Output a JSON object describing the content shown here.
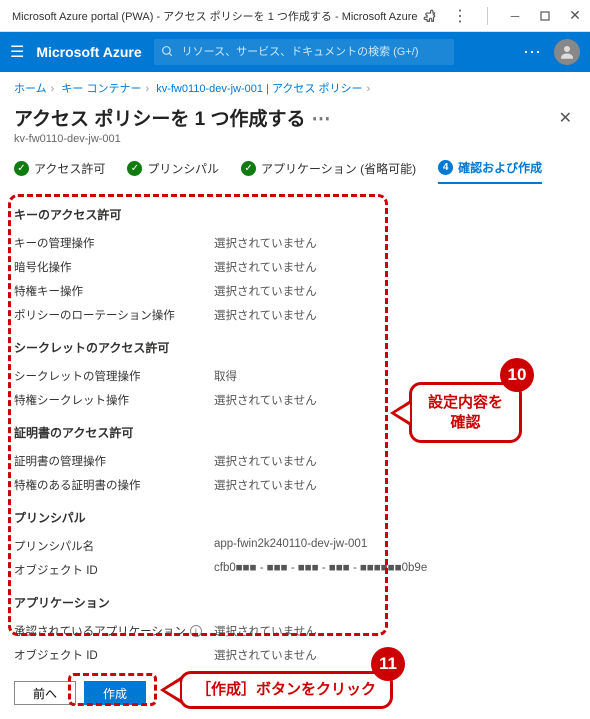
{
  "chrome": {
    "title": "Microsoft Azure portal (PWA) - アクセス ポリシーを 1 つ作成する - Microsoft Azure"
  },
  "topbar": {
    "brand": "Microsoft Azure",
    "search_placeholder": "リソース、サービス、ドキュメントの検索 (G+/)"
  },
  "breadcrumb": {
    "items": [
      "ホーム",
      "キー コンテナー",
      "kv-fw0110-dev-jw-001 | アクセス ポリシー"
    ]
  },
  "header": {
    "title": "アクセス ポリシーを 1 つ作成する",
    "subtitle": "kv-fw0110-dev-jw-001"
  },
  "steps": {
    "s0": "アクセス許可",
    "s1": "プリンシパル",
    "s2": "アプリケーション (省略可能)",
    "s3": "確認および作成"
  },
  "sections": {
    "key_perms": {
      "title": "キーのアクセス許可",
      "r0": {
        "lbl": "キーの管理操作",
        "val": "選択されていません"
      },
      "r1": {
        "lbl": "暗号化操作",
        "val": "選択されていません"
      },
      "r2": {
        "lbl": "特権キー操作",
        "val": "選択されていません"
      },
      "r3": {
        "lbl": "ポリシーのローテーション操作",
        "val": "選択されていません"
      }
    },
    "secret_perms": {
      "title": "シークレットのアクセス許可",
      "r0": {
        "lbl": "シークレットの管理操作",
        "val": "取得"
      },
      "r1": {
        "lbl": "特権シークレット操作",
        "val": "選択されていません"
      }
    },
    "cert_perms": {
      "title": "証明書のアクセス許可",
      "r0": {
        "lbl": "証明書の管理操作",
        "val": "選択されていません"
      },
      "r1": {
        "lbl": "特権のある証明書の操作",
        "val": "選択されていません"
      }
    },
    "principal": {
      "title": "プリンシパル",
      "r0": {
        "lbl": "プリンシパル名",
        "val": "app-fwin2k240110-dev-jw-001"
      },
      "r1": {
        "lbl": "オブジェクト ID",
        "val": "cfb0■■■ - ■■■ - ■■■ - ■■■ - ■■■■■■0b9e"
      }
    },
    "application": {
      "title": "アプリケーション",
      "r0": {
        "lbl": "承認されているアプリケーション",
        "val": "選択されていません"
      },
      "r1": {
        "lbl": "オブジェクト ID",
        "val": "選択されていません"
      }
    }
  },
  "footer": {
    "back": "前へ",
    "create": "作成"
  },
  "callouts": {
    "c10": {
      "num": "10",
      "text_l1": "設定内容を",
      "text_l2": "確認"
    },
    "c11": {
      "num": "11",
      "text": "［作成］ボタンをクリック"
    }
  }
}
